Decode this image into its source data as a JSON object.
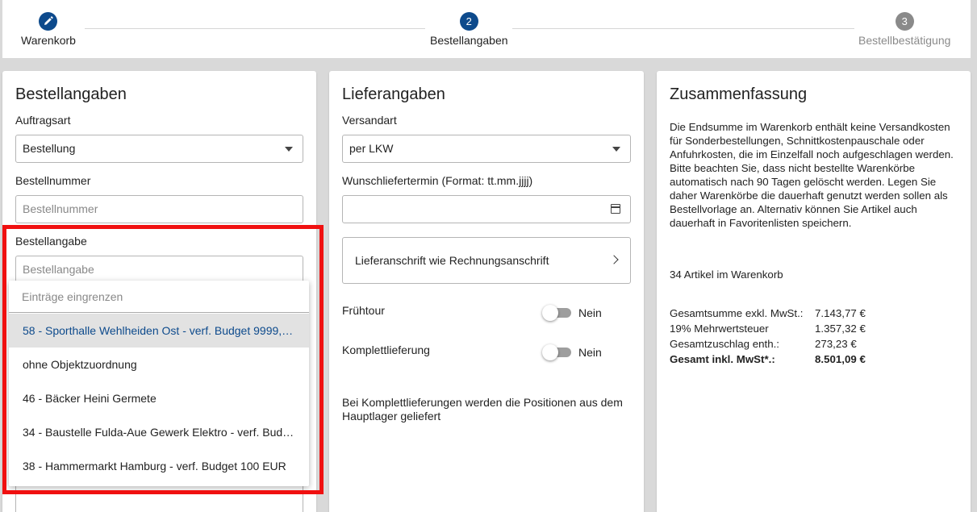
{
  "stepper": {
    "steps": [
      {
        "number": "",
        "label": "Warenkorb",
        "icon": "pencil-icon"
      },
      {
        "number": "2",
        "label": "Bestellangaben"
      },
      {
        "number": "3",
        "label": "Bestellbestätigung"
      }
    ]
  },
  "bestellangaben": {
    "title": "Bestellangaben",
    "auftragsart_label": "Auftragsart",
    "auftragsart_value": "Bestellung",
    "bestellnummer_label": "Bestellnummer",
    "bestellnummer_placeholder": "Bestellnummer",
    "bestellangabe_label": "Bestellangabe",
    "bestellangabe_placeholder": "Bestellangabe",
    "dropdown": {
      "filter_placeholder": "Einträge eingrenzen",
      "items": [
        "58 - Sporthalle Wehlheiden Ost - verf. Budget 9999,9…",
        "ohne Objektzuordnung",
        "46 - Bäcker Heini Germete",
        "34 - Baustelle Fulda-Aue Gewerk Elektro - verf. Budge…",
        "38 - Hammermarkt Hamburg - verf. Budget 100 EUR"
      ]
    }
  },
  "lieferangaben": {
    "title": "Lieferangaben",
    "versandart_label": "Versandart",
    "versandart_value": "per LKW",
    "termin_label": "Wunschliefertermin (Format: tt.mm.jjjj)",
    "address_button": "Lieferanschrift wie Rechnungsanschrift",
    "fruehtour_label": "Frühtour",
    "fruehtour_value": "Nein",
    "komplett_label": "Komplettlieferung",
    "komplett_value": "Nein",
    "komplett_info": "Bei Komplettlieferungen werden die Positionen aus dem Hauptlager geliefert"
  },
  "zusammenfassung": {
    "title": "Zusammenfassung",
    "text": "Die Endsumme im Warenkorb enthält keine Versandkosten für Sonderbestellungen, Schnittkostenpauschale oder Anfuhrkosten, die im Einzelfall noch aufgeschlagen werden. Bitte beachten Sie, dass nicht bestellte Warenkörbe automatisch nach 90 Tagen gelöscht werden. Legen Sie daher Warenkörbe die dauerhaft genutzt werden sollen als Bestellvorlage an. Alternativ können Sie Artikel auch dauerhaft in Favoritenlisten speichern.",
    "article_count": "34 Artikel im Warenkorb",
    "rows": [
      {
        "label": "Gesamtsumme exkl. MwSt.:",
        "value": "7.143,77 €"
      },
      {
        "label": "19% Mehrwertsteuer",
        "value": "1.357,32 €"
      },
      {
        "label": "Gesamtzuschlag enth.:",
        "value": "273,23 €"
      },
      {
        "label": "Gesamt inkl. MwSt*.:",
        "value": "8.501,09 €"
      }
    ]
  },
  "colors": {
    "accent": "#0d4a8c",
    "highlight": "#f01010"
  }
}
